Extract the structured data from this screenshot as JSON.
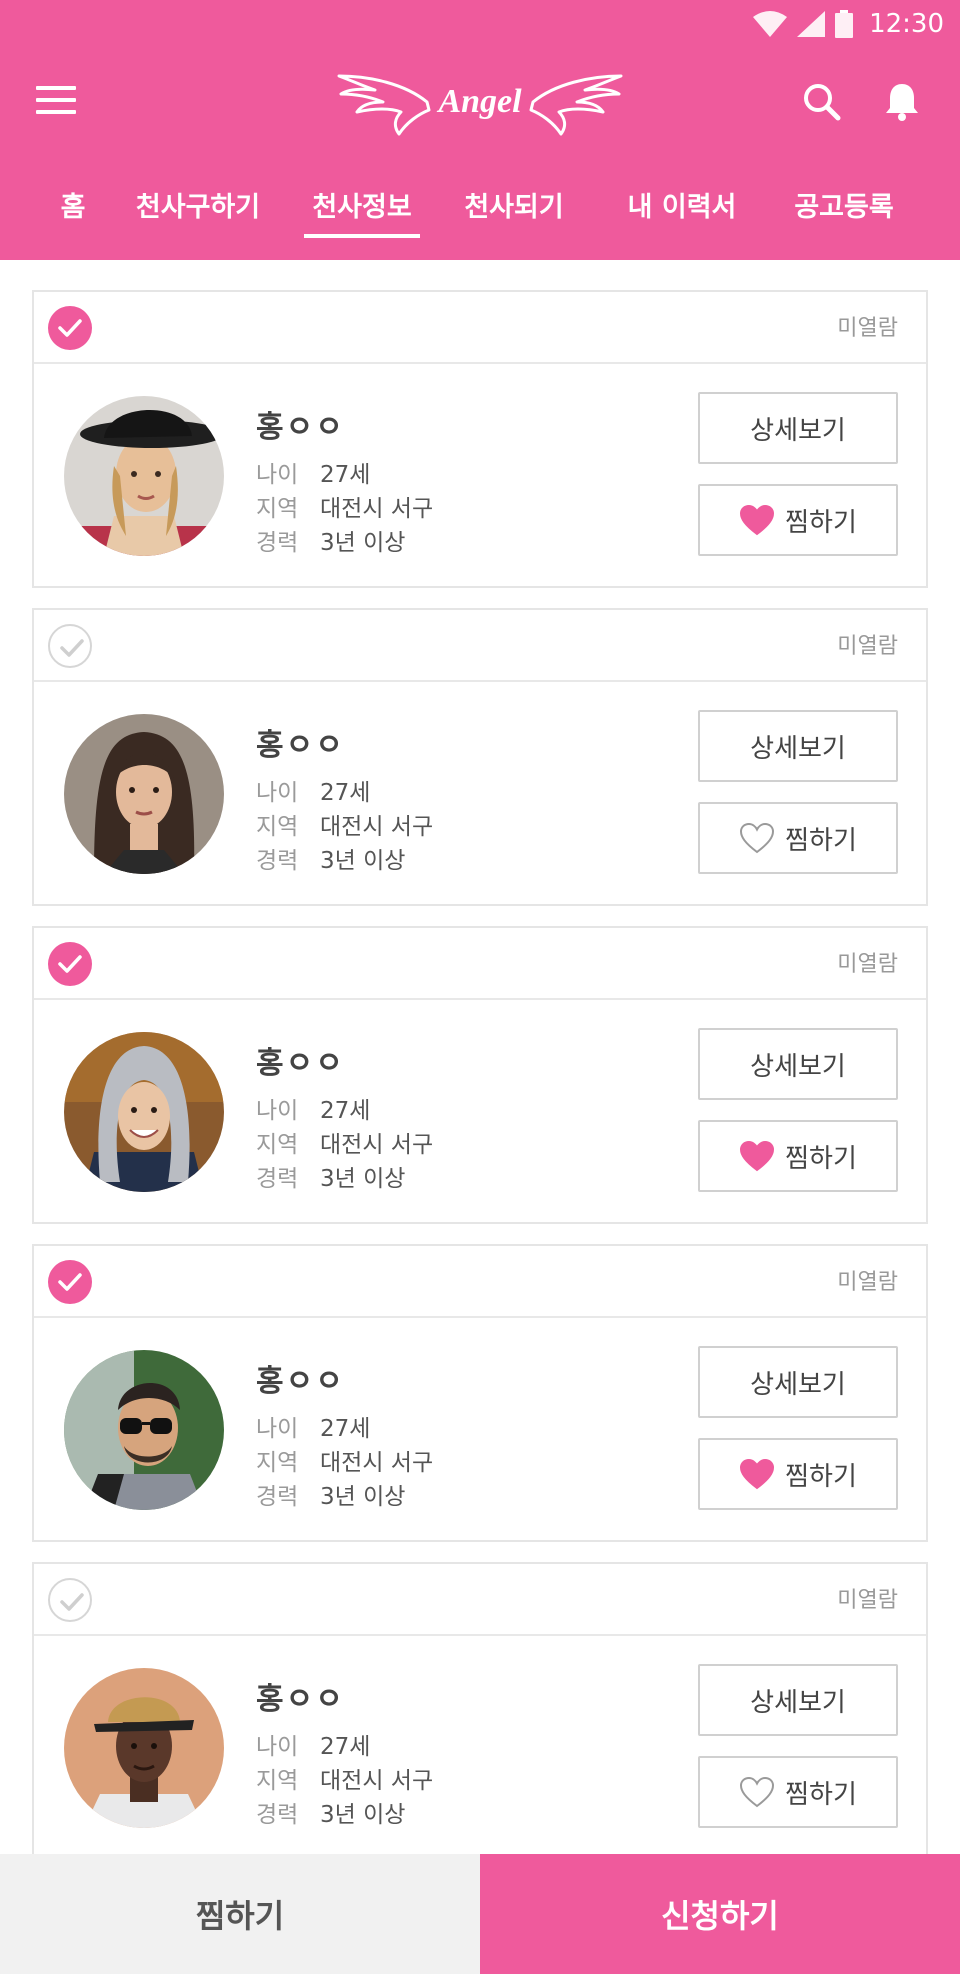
{
  "status_bar": {
    "time": "12:30",
    "icons": [
      "wifi-icon",
      "signal-icon",
      "battery-icon"
    ]
  },
  "header": {
    "logo_text": "Angel",
    "menu_icon": "hamburger-icon",
    "search_icon": "search-icon",
    "bell_icon": "bell-icon",
    "brand_color": "#ef5a9c"
  },
  "tabs": [
    {
      "label": "홈",
      "active": false
    },
    {
      "label": "천사구하기",
      "active": false
    },
    {
      "label": "천사정보",
      "active": true
    },
    {
      "label": "천사되기",
      "active": false
    },
    {
      "label": "내 이력서",
      "active": false
    },
    {
      "label": "공고등록",
      "active": false
    }
  ],
  "labels": {
    "age": "나이",
    "region": "지역",
    "career": "경력",
    "detail_button": "상세보기",
    "zzim_button": "찜하기"
  },
  "cards": [
    {
      "checked": true,
      "status": "미열람",
      "name": "홍ㅇㅇ",
      "age": "27세",
      "region": "대전시 서구",
      "career": "3년 이상",
      "zzim": true,
      "avatar": "woman-hat"
    },
    {
      "checked": false,
      "status": "미열람",
      "name": "홍ㅇㅇ",
      "age": "27세",
      "region": "대전시 서구",
      "career": "3년 이상",
      "zzim": false,
      "avatar": "woman-long-hair"
    },
    {
      "checked": true,
      "status": "미열람",
      "name": "홍ㅇㅇ",
      "age": "27세",
      "region": "대전시 서구",
      "career": "3년 이상",
      "zzim": true,
      "avatar": "woman-hoodie"
    },
    {
      "checked": true,
      "status": "미열람",
      "name": "홍ㅇㅇ",
      "age": "27세",
      "region": "대전시 서구",
      "career": "3년 이상",
      "zzim": true,
      "avatar": "man-sunglasses"
    },
    {
      "checked": false,
      "status": "미열람",
      "name": "홍ㅇㅇ",
      "age": "27세",
      "region": "대전시 서구",
      "career": "3년 이상",
      "zzim": false,
      "avatar": "man-cap"
    }
  ],
  "bottom": {
    "left_label": "찜하기",
    "right_label": "신청하기"
  }
}
